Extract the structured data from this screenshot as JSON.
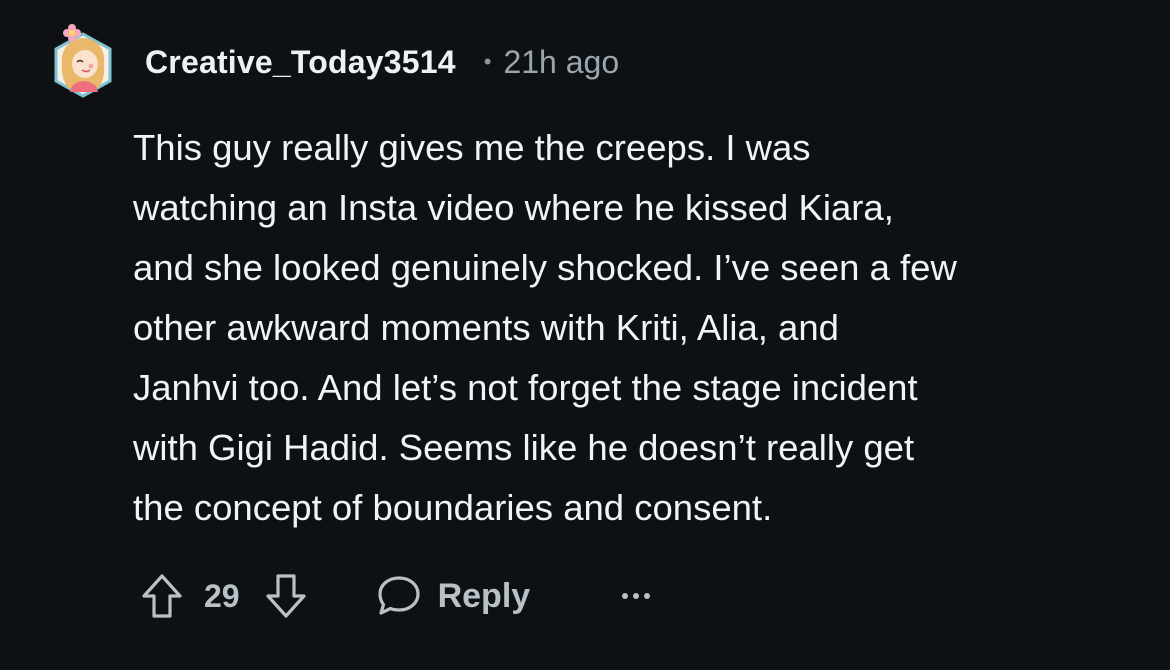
{
  "comment": {
    "username": "Creative_Today3514",
    "separator": "•",
    "timestamp": "21h ago",
    "body": "This guy really gives me the creeps. I was\nwatching an Insta video where he kissed Kiara,\nand she looked genuinely shocked. I’ve seen a few\nother awkward moments with Kriti, Alia, and\nJanhvi too. And let’s not forget the stage incident\nwith Gigi Hadid. Seems like he doesn’t really get\nthe concept of boundaries and consent.",
    "votes": "29",
    "reply_label": "Reply"
  },
  "colors": {
    "background": "#0e1113",
    "text": "#f2f3f5",
    "muted": "#9aa6ad",
    "action": "#b7c1c7",
    "avatar_ring": "#7fc4d3"
  },
  "icons": {
    "upvote": "arrow-up-icon",
    "downvote": "arrow-down-icon",
    "reply": "speech-bubble-icon",
    "more": "ellipsis-icon"
  }
}
